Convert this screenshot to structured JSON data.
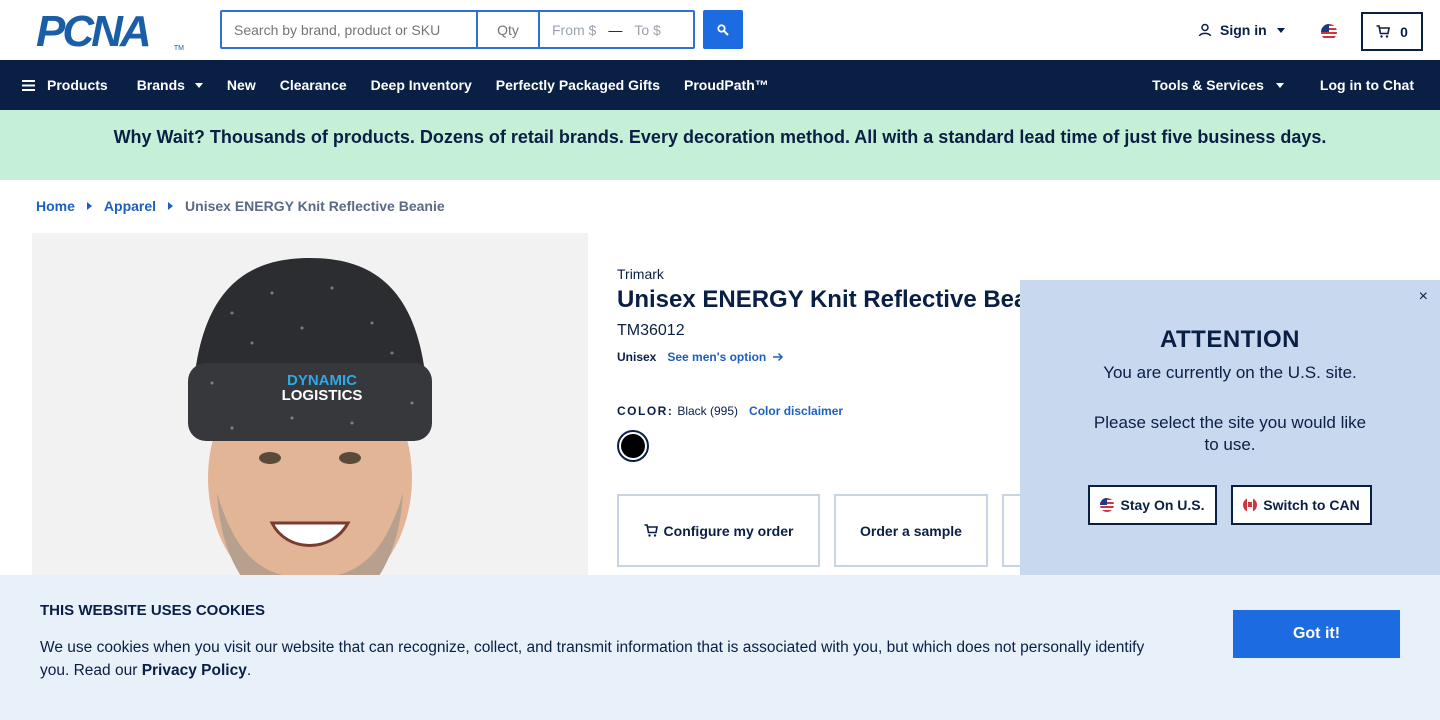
{
  "header": {
    "logo_text": "PCNA",
    "logo_tm": "TM",
    "search_placeholder": "Search by brand, product or SKU",
    "qty_placeholder": "Qty",
    "price_from_placeholder": "From $",
    "price_dash": "—",
    "price_to_placeholder": "To $",
    "signin_label": "Sign in",
    "cart_count": "0"
  },
  "nav": {
    "left": [
      {
        "label": "Products",
        "icon": "menu-icon"
      },
      {
        "label": "Brands",
        "dropdown": true
      },
      {
        "label": "New"
      },
      {
        "label": "Clearance"
      },
      {
        "label": "Deep Inventory"
      },
      {
        "label": "Perfectly Packaged Gifts"
      },
      {
        "label": "ProudPath™"
      }
    ],
    "right": [
      {
        "label": "Tools & Services",
        "dropdown": true
      },
      {
        "label": "Log in to Chat"
      }
    ]
  },
  "banner": {
    "text": "Why Wait? Thousands of products. Dozens of retail brands. Every decoration method. All with a standard lead time of just five business days."
  },
  "breadcrumb": {
    "items": [
      "Home",
      "Apparel"
    ],
    "current": "Unisex ENERGY Knit Reflective Beanie"
  },
  "product": {
    "brand": "Trimark",
    "title": "Unisex ENERGY Knit Reflective Beanie",
    "sku": "TM36012",
    "gender": "Unisex",
    "alt_option": "See men's option",
    "color_label": "COLOR:",
    "color_value": "Black (995)",
    "color_disclaimer": "Color disclaimer",
    "swatch_color": "#000000",
    "image_logo_line1": "DYNAMIC",
    "image_logo_line2": "LOGISTICS",
    "actions": [
      "Configure my order",
      "Order a sample"
    ]
  },
  "modal": {
    "close": "×",
    "title": "ATTENTION",
    "message": "You are currently on the U.S. site.",
    "prompt": "Please select the site you would like to use.",
    "stay_label": "Stay On U.S.",
    "switch_label": "Switch to CAN"
  },
  "cookie": {
    "title": "THIS WEBSITE USES COOKIES",
    "text_before": "We use cookies when you visit our website that can recognize, collect, and transmit information that is associated with you, but which does not personally identify you. Read our ",
    "link": "Privacy Policy",
    "text_after": ".",
    "button": "Got it!"
  },
  "colors": {
    "navy": "#0a1f44",
    "accent_blue": "#1d6be0",
    "banner_green": "#c6efd8",
    "modal_bg": "#c8d8ef",
    "cookie_bg": "#e8f0fa"
  }
}
